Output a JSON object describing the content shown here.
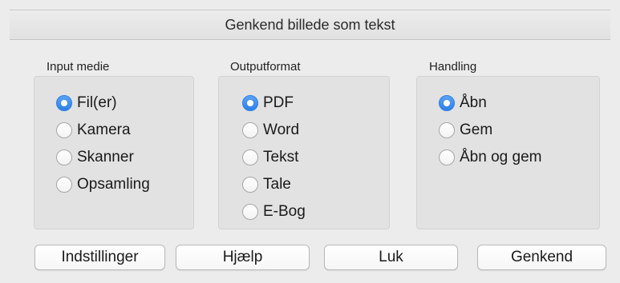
{
  "window": {
    "title": "Genkend billede som tekst"
  },
  "groups": {
    "input": {
      "label": "Input medie",
      "options": [
        "Fil(er)",
        "Kamera",
        "Skanner",
        "Opsamling"
      ],
      "selected": "Fil(er)"
    },
    "output": {
      "label": "Outputformat",
      "options": [
        "PDF",
        "Word",
        "Tekst",
        "Tale",
        "E-Bog"
      ],
      "selected": "PDF"
    },
    "action": {
      "label": "Handling",
      "options": [
        "Åbn",
        "Gem",
        "Åbn og gem"
      ],
      "selected": "Åbn"
    }
  },
  "buttons": {
    "settings": "Indstillinger",
    "help": "Hjælp",
    "close": "Luk",
    "recognize": "Genkend"
  },
  "colors": {
    "accent": "#2e80e8",
    "background": "#ececec",
    "group_bg": "#e2e2e2"
  }
}
